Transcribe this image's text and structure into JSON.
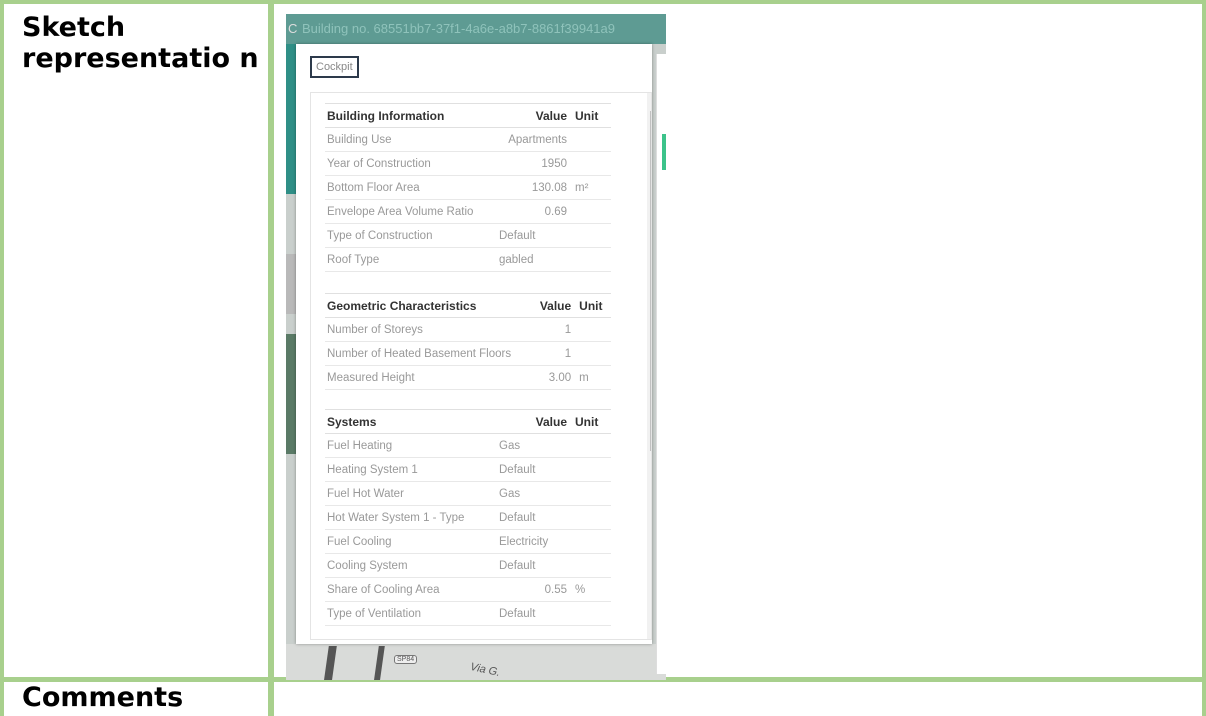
{
  "document": {
    "row1_label": "Sketch representatio n",
    "row2_label": "Comments"
  },
  "window": {
    "title_prefix": "C",
    "title": "Building no. 68551bb7-37f1-4a6e-a8b7-8861f39941a9",
    "tab": "Cockpit"
  },
  "map": {
    "labels": [
      "SP84",
      "Via G."
    ]
  },
  "building_information": {
    "header": {
      "name": "Building Information",
      "value": "Value",
      "unit": "Unit"
    },
    "rows": [
      {
        "name": "Building Use",
        "value": "Apartments",
        "unit": ""
      },
      {
        "name": "Year of Construction",
        "value": "1950",
        "unit": ""
      },
      {
        "name": "Bottom Floor Area",
        "value": "130.08",
        "unit": "m²"
      },
      {
        "name": "Envelope Area Volume Ratio",
        "value": "0.69",
        "unit": ""
      },
      {
        "name": "Type of Construction",
        "value": "Default",
        "unit": ""
      },
      {
        "name": "Roof Type",
        "value": "gabled",
        "unit": ""
      }
    ]
  },
  "geometric_characteristics": {
    "header": {
      "name": "Geometric Characteristics",
      "value": "Value",
      "unit": "Unit"
    },
    "rows": [
      {
        "name": "Number of Storeys",
        "value": "1",
        "unit": ""
      },
      {
        "name": "Number of Heated Basement Floors",
        "value": "1",
        "unit": ""
      },
      {
        "name": "Measured Height",
        "value": "3.00",
        "unit": "m"
      }
    ]
  },
  "systems": {
    "header": {
      "name": "Systems",
      "value": "Value",
      "unit": "Unit"
    },
    "rows": [
      {
        "name": "Fuel Heating",
        "value": "Gas",
        "unit": ""
      },
      {
        "name": "Heating System 1",
        "value": "Default",
        "unit": ""
      },
      {
        "name": "Fuel Hot Water",
        "value": "Gas",
        "unit": ""
      },
      {
        "name": "Hot Water System 1 - Type",
        "value": "Default",
        "unit": ""
      },
      {
        "name": "Fuel Cooling",
        "value": "Electricity",
        "unit": ""
      },
      {
        "name": "Cooling System",
        "value": "Default",
        "unit": ""
      },
      {
        "name": "Share of Cooling Area",
        "value": "0.55",
        "unit": "%"
      },
      {
        "name": "Type of Ventilation",
        "value": "Default",
        "unit": ""
      }
    ]
  }
}
